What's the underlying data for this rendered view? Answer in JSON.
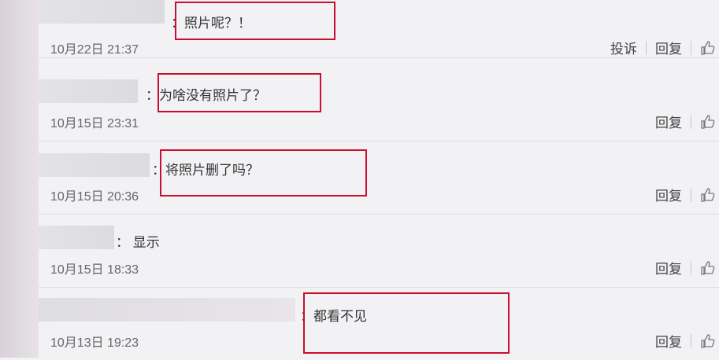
{
  "comments": [
    {
      "text": "：照片呢？！",
      "time": "10月22日 21:37",
      "report": "投诉",
      "reply": "回复"
    },
    {
      "text": "：为啥没有照片了？",
      "time": "10月15日 23:31",
      "reply": "回复"
    },
    {
      "text": "：将照片删了吗？",
      "time": "10月15日 20:36",
      "reply": "回复"
    },
    {
      "text": "： 显示",
      "time": "10月15日 18:33",
      "reply": "回复"
    },
    {
      "text": "：都看不见",
      "time": "10月13日 19:23",
      "reply": "回复"
    }
  ],
  "icons": {
    "like": "thumbs-up-icon"
  },
  "colors": {
    "highlight": "#c8102e",
    "background": "#f2f1f4"
  }
}
